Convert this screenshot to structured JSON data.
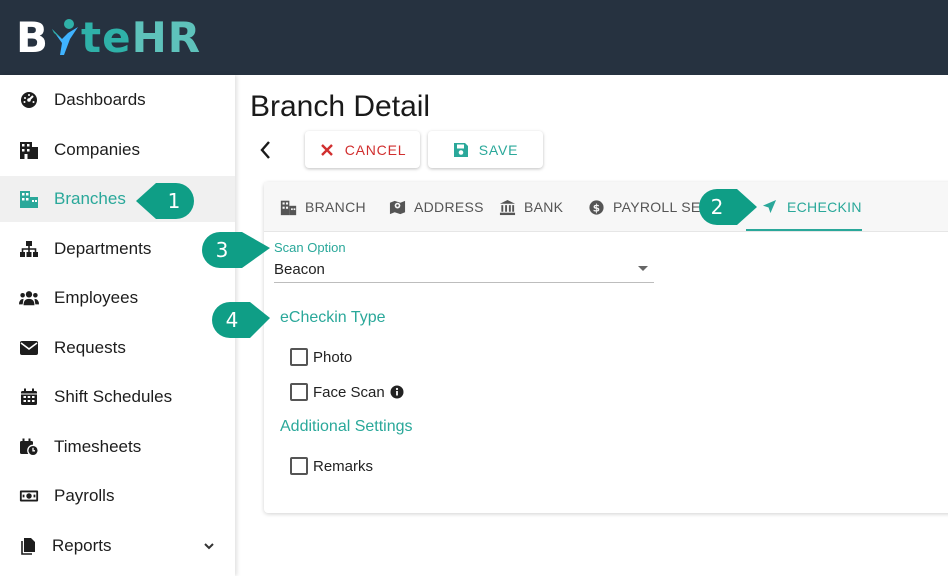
{
  "app": {
    "logo_text": "BYteHR",
    "colors": {
      "topbar": "#263240",
      "accent": "#2aa89a",
      "danger": "#d12f2f",
      "callout": "#0f9e86"
    }
  },
  "sidebar": {
    "items": [
      {
        "label": "Dashboards",
        "icon": "dashboard-icon"
      },
      {
        "label": "Companies",
        "icon": "building-icon"
      },
      {
        "label": "Branches",
        "icon": "branch-icon",
        "active": true
      },
      {
        "label": "Departments",
        "icon": "sitemap-icon"
      },
      {
        "label": "Employees",
        "icon": "users-icon"
      },
      {
        "label": "Requests",
        "icon": "envelope-icon"
      },
      {
        "label": "Shift Schedules",
        "icon": "calendar-icon"
      },
      {
        "label": "Timesheets",
        "icon": "calendar-clock-icon"
      },
      {
        "label": "Payrolls",
        "icon": "money-icon"
      },
      {
        "label": "Reports",
        "icon": "file-icon"
      }
    ]
  },
  "page": {
    "title": "Branch Detail",
    "cancel_label": "CANCEL",
    "save_label": "SAVE"
  },
  "tabs": [
    {
      "label": "BRANCH"
    },
    {
      "label": "ADDRESS"
    },
    {
      "label": "BANK"
    },
    {
      "label": "PAYROLL SET"
    },
    {
      "label": "ECHECKIN",
      "active": true
    }
  ],
  "form": {
    "scan_option_label": "Scan Option",
    "scan_option_value": "Beacon",
    "echeckin_type_title": "eCheckin Type",
    "photo_label": "Photo",
    "face_scan_label": "Face Scan",
    "additional_settings_title": "Additional Settings",
    "remarks_label": "Remarks"
  },
  "callouts": [
    "1",
    "2",
    "3",
    "4"
  ]
}
